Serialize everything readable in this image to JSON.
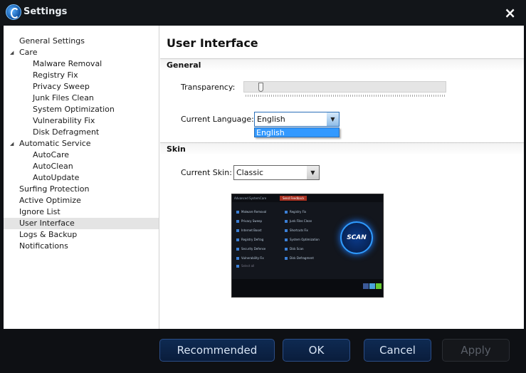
{
  "window": {
    "title": "Settings",
    "close_icon": "×"
  },
  "sidebar": {
    "items": [
      {
        "label": "General Settings",
        "level": 0
      },
      {
        "label": "Care",
        "level": 0,
        "expander": "◢"
      },
      {
        "label": "Malware Removal",
        "level": 1
      },
      {
        "label": "Registry Fix",
        "level": 1
      },
      {
        "label": "Privacy Sweep",
        "level": 1
      },
      {
        "label": "Junk Files Clean",
        "level": 1
      },
      {
        "label": "System Optimization",
        "level": 1
      },
      {
        "label": "Vulnerability Fix",
        "level": 1
      },
      {
        "label": "Disk Defragment",
        "level": 1
      },
      {
        "label": "Automatic Service",
        "level": 0,
        "expander": "◢"
      },
      {
        "label": "AutoCare",
        "level": 1
      },
      {
        "label": "AutoClean",
        "level": 1
      },
      {
        "label": "AutoUpdate",
        "level": 1
      },
      {
        "label": "Surfing Protection",
        "level": 0
      },
      {
        "label": "Active Optimize",
        "level": 0
      },
      {
        "label": "Ignore List",
        "level": 0
      },
      {
        "label": "User Interface",
        "level": 0,
        "selected": true
      },
      {
        "label": "Logs & Backup",
        "level": 0
      },
      {
        "label": "Notifications",
        "level": 0
      }
    ]
  },
  "main": {
    "title": "User Interface",
    "general": {
      "header": "General",
      "transparency_label": "Transparency:",
      "transparency_value": 0.05,
      "language_label": "Current Language:",
      "language_value": "English",
      "language_options": [
        "English"
      ],
      "arrow": "▼"
    },
    "skin": {
      "header": "Skin",
      "skin_label": "Current Skin:",
      "skin_value": "Classic",
      "arrow": "▼",
      "preview": {
        "app": "Advanced SystemCare",
        "feedback": "Send Feedback",
        "scan": "SCAN",
        "items_left": [
          "Malware Removal",
          "Privacy Sweep",
          "Internet Boost",
          "Registry Defrag",
          "Security Defense",
          "Vulnerability Fix"
        ],
        "items_right": [
          "Registry Fix",
          "Junk Files Clean",
          "Shortcuts Fix",
          "System Optimization",
          "Disk Scan",
          "Disk Defragment"
        ],
        "select_all": "Select all"
      }
    }
  },
  "footer": {
    "recommended": "Recommended",
    "ok": "OK",
    "cancel": "Cancel",
    "apply": "Apply"
  }
}
